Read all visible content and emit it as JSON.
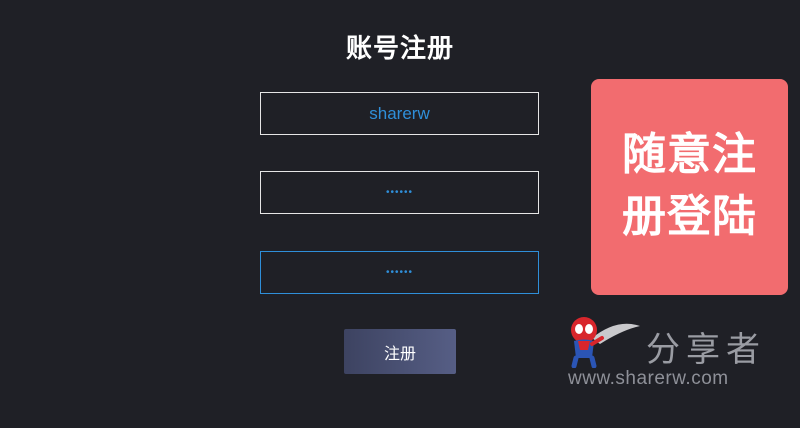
{
  "form": {
    "title": "账号注册",
    "username_value": "sharerw",
    "password_value": "••••••",
    "confirm_password_value": "••••••",
    "submit_label": "注册"
  },
  "banner": {
    "line1": "随意注",
    "line2": "册登陆",
    "color": "#f26c6f"
  },
  "watermark": {
    "brand": "分享者",
    "url": "www.sharerw.com",
    "icon": "spiderman-mascot-icon"
  },
  "colors": {
    "background": "#1f2026",
    "accent": "#2f8fd9",
    "button_start": "#3d4361",
    "button_end": "#565e85"
  }
}
